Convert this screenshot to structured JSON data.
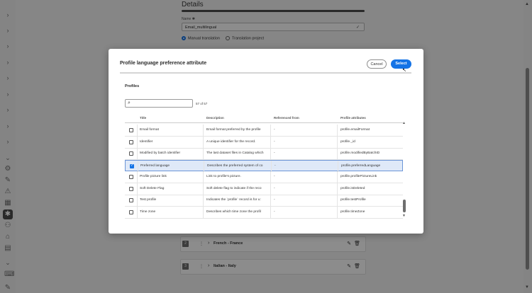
{
  "background": {
    "details_title": "Details",
    "name_label": "Name ✱",
    "name_value": "Email_multilingual",
    "radio_manual": "Manual translation",
    "radio_project": "Translation project",
    "lang_cards": [
      {
        "num": "2",
        "label": "French - France"
      },
      {
        "num": "3",
        "label": "Italian - Italy"
      }
    ]
  },
  "modal": {
    "title": "Profile language preference attribute",
    "cancel_label": "Cancel",
    "select_label": "Select",
    "section_title": "Profiles",
    "search_placeholder": "",
    "count": "57 of 57",
    "columns": [
      "Title",
      "Description",
      "Referenced from",
      "Profile attributes"
    ],
    "rows": [
      {
        "title": "Email format",
        "description": "Email format preferred by the profile",
        "ref": "-",
        "attr": "profile.emailFormat",
        "selected": false
      },
      {
        "title": "Identifier",
        "description": "A unique identifier for the record.",
        "ref": "-",
        "attr": "profile._id",
        "selected": false
      },
      {
        "title": "Modified by batch identifier",
        "description": "The last dataset files in Catalog which",
        "ref": "-",
        "attr": "profile.modifiedByBatchID",
        "selected": false
      },
      {
        "title": "Preferred language",
        "description": "Describes the preferred system of co",
        "ref": "-",
        "attr": "profile.preferredLanguage",
        "selected": true
      },
      {
        "title": "Profile picture link",
        "description": "Link to profile's picture.",
        "ref": "-",
        "attr": "profile.profilePictureLink",
        "selected": false
      },
      {
        "title": "Soft Delete Flag",
        "description": "Soft delete flag to indicate if the reco",
        "ref": "-",
        "attr": "profile.isDeleted",
        "selected": false
      },
      {
        "title": "Test profile",
        "description": "Indicates the `profile` record is for u:",
        "ref": "-",
        "attr": "profile.testProfile",
        "selected": false
      },
      {
        "title": "Time zone",
        "description": "Describes which time zone the profil",
        "ref": "-",
        "attr": "profile.timeZone",
        "selected": false
      }
    ]
  },
  "colors": {
    "accent": "#1473e6",
    "selected_row": "#dfe9f8",
    "overlay": "rgba(0,0,0,0.45)"
  }
}
